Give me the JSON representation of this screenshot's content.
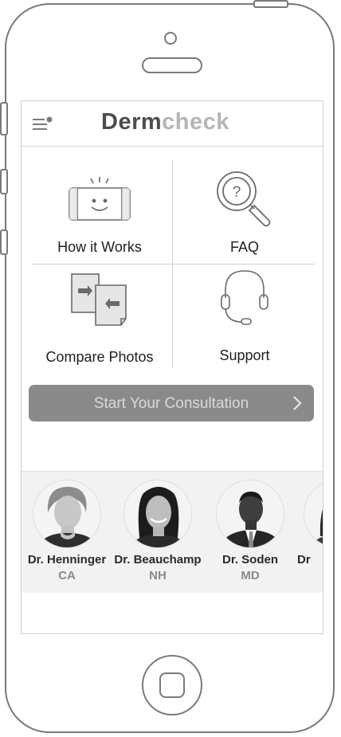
{
  "app": {
    "logo_part1": "Derm",
    "logo_part2": "check"
  },
  "icons": {
    "menu": "hamburger-menu-icon",
    "how_it_works": "phone-smile-icon",
    "faq": "magnifier-question-icon",
    "compare": "compare-photos-icon",
    "support": "headset-icon",
    "cta": "chevron-right-icon"
  },
  "tiles": [
    {
      "label": "How it Works"
    },
    {
      "label": "FAQ"
    },
    {
      "label": "Compare Photos"
    },
    {
      "label": "Support"
    }
  ],
  "cta": {
    "label": "Start Your Consultation"
  },
  "doctors": [
    {
      "name": "Dr. Henninger",
      "state": "CA"
    },
    {
      "name": "Dr. Beauchamp",
      "state": "NH"
    },
    {
      "name": "Dr. Soden",
      "state": "MD"
    },
    {
      "name": "Dr",
      "state": ""
    }
  ],
  "colors": {
    "cta_bg": "#8a8a8a",
    "cta_text": "#d9d9d9",
    "logo_dark": "#4d4d4d",
    "logo_light": "#b5b5b5"
  }
}
